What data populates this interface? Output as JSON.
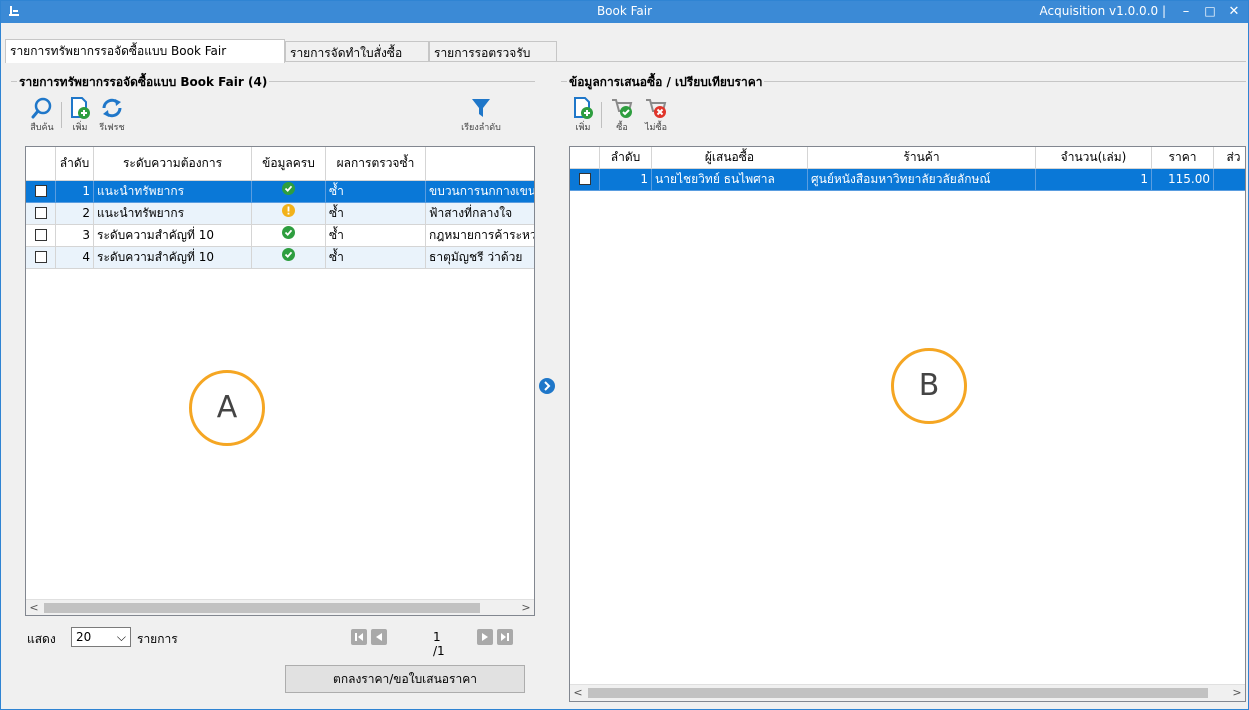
{
  "window": {
    "title": "Book Fair",
    "version": "Acquisition v1.0.0.0 |",
    "minimize": "–",
    "maximize": "□",
    "close": "✕"
  },
  "tabs": [
    {
      "label": "รายการทรัพยากรรอจัดซื้อแบบ Book Fair"
    },
    {
      "label": "รายการจัดทำใบสั่งซื้อ"
    },
    {
      "label": "รายการรอตรวจรับ"
    }
  ],
  "left": {
    "group_title": "รายการทรัพยากรรอจัดซื้อแบบ Book Fair (4)",
    "toolbar": {
      "search": "สืบค้น",
      "add": "เพิ่ม",
      "refresh": "รีเฟรช",
      "sort": "เรียงลำดับ"
    },
    "columns": [
      "ลำดับ",
      "ระดับความต้องการ",
      "ข้อมูลครบ",
      "ผลการตรวจซ้ำ",
      ""
    ],
    "rows": [
      {
        "no": "1",
        "level": "แนะนำทรัพยากร",
        "complete": "ok",
        "dup": "ซ้ำ",
        "title": "ขบวนการนกกางเขน"
      },
      {
        "no": "2",
        "level": "แนะนำทรัพยากร",
        "complete": "warn",
        "dup": "ซ้ำ",
        "title": "ฟ้าสางที่กลางใจ"
      },
      {
        "no": "3",
        "level": "ระดับความสำคัญที่ 10",
        "complete": "ok",
        "dup": "ซ้ำ",
        "title": "กฎหมายการค้าระหว่าง"
      },
      {
        "no": "4",
        "level": "ระดับความสำคัญที่ 10",
        "complete": "ok",
        "dup": "ซ้ำ",
        "title": "ธาตุมัญชรี ว่าด้วย"
      }
    ],
    "annotation": "A",
    "pager": {
      "show_label": "แสดง",
      "page_size": "20",
      "items_label": "รายการ",
      "page_info": "1 /1"
    },
    "confirm_button": "ตกลงราคา/ขอใบเสนอราคา"
  },
  "right": {
    "group_title": "ข้อมูลการเสนอซื้อ / เปรียบเทียบราคา",
    "toolbar": {
      "add": "เพิ่ม",
      "buy": "ซื้อ",
      "not_buy": "ไม่ซื้อ"
    },
    "columns": [
      "ลำดับ",
      "ผู้เสนอซื้อ",
      "ร้านค้า",
      "จำนวน(เล่ม)",
      "ราคา",
      "ส่ว"
    ],
    "rows": [
      {
        "no": "1",
        "proposer": "นายไชยวิทย์ ธนไพศาล",
        "store": "ศูนย์หนังสือมหาวิทยาลัยวลัยลักษณ์",
        "qty": "1",
        "price": "115.00",
        "discount": ""
      }
    ],
    "annotation": "B"
  },
  "colors": {
    "titlebar": "#3b8ad6",
    "selection": "#0a78d7",
    "ok": "#2e9e3f",
    "warn": "#f2b21a",
    "annotation": "#f5a623"
  }
}
